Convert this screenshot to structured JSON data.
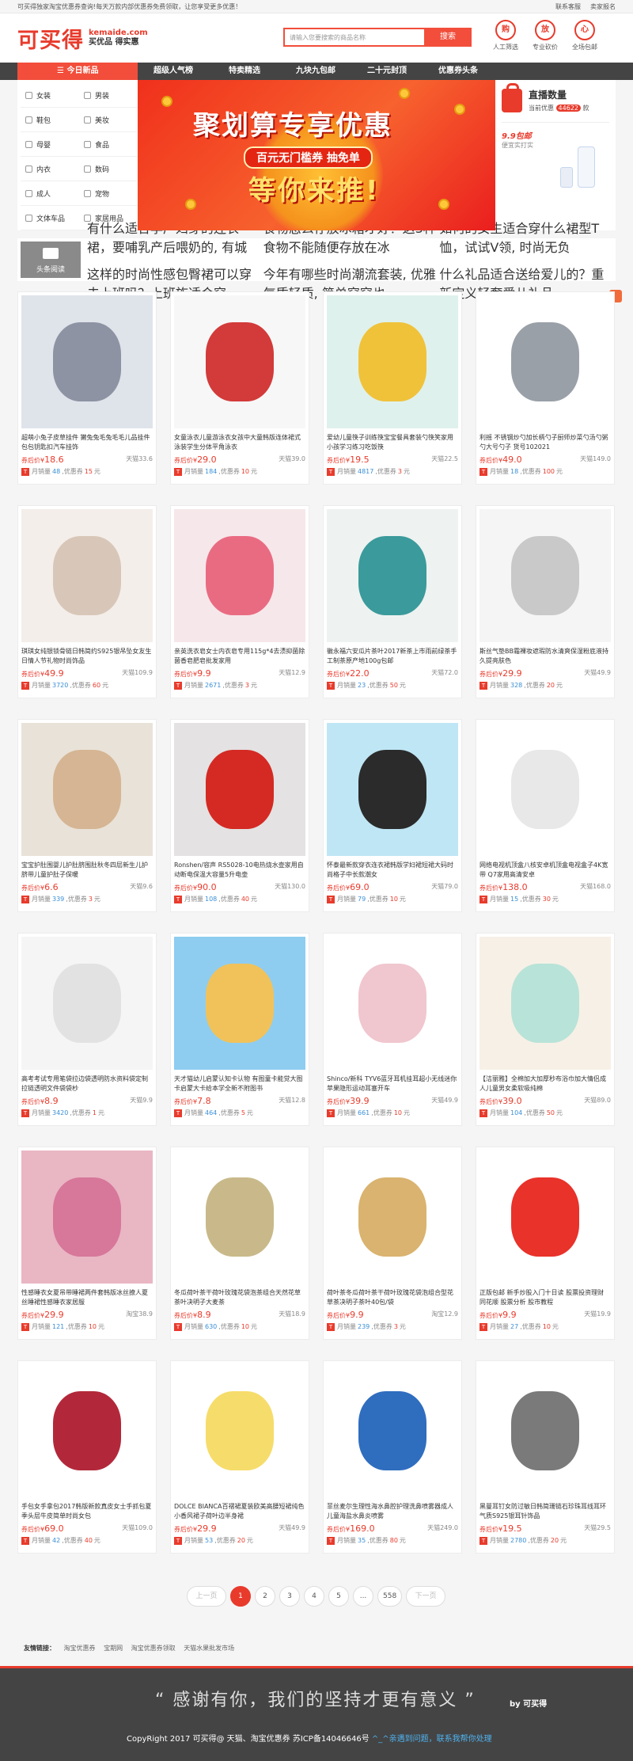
{
  "topbar": {
    "left": "可买得独家淘宝优惠券查询!每天万款内部优惠券免费领取，让您享受更多优惠！",
    "help": "联系客服",
    "join": "卖家报名"
  },
  "header": {
    "logo": "可买得",
    "domain": "kemaide.com",
    "slogan": "买优品 得实惠",
    "search_placeholder": "请输入您要搜索的商品名称",
    "search_button": "搜索",
    "icons": [
      {
        "glyph": "购",
        "label": "人工筛选"
      },
      {
        "glyph": "放",
        "label": "专业砍价"
      },
      {
        "glyph": "心",
        "label": "全场包邮"
      }
    ]
  },
  "nav": {
    "category": "☰ 今日新品",
    "items": [
      "超级人气榜",
      "特卖精选",
      "九块九包邮",
      "二十元封顶",
      "优惠券头条"
    ]
  },
  "categories": [
    [
      "女装",
      "男装"
    ],
    [
      "鞋包",
      "美妆"
    ],
    [
      "母婴",
      "食品"
    ],
    [
      "内衣",
      "数码"
    ],
    [
      "成人",
      "宠物"
    ],
    [
      "文体车品",
      "家居用品"
    ]
  ],
  "banner": {
    "line1": "聚划算专享优惠",
    "line2": "百元无门槛券 抽免单",
    "line3": "等你来推!"
  },
  "side": {
    "live_title": "直播数量",
    "live_prefix": "当前优惠",
    "live_count": "44622",
    "live_suffix": "款",
    "ninep_title": "9.9包邮",
    "ninep_sub": "便宜实打实"
  },
  "headline": {
    "label": "头条阅读",
    "items": [
      "有什么适合孕产妇穿的连衣裙，要哺乳产后喂奶的, 有城",
      "食物怎么存放冰箱才好？这3种食物不能随便存放在冰",
      "如何的女生适合穿什么裙型T恤，试试V领, 时尚无负",
      "这样的时尚性感包臀裙可以穿去上班吗？上班族适合穿",
      "今年有哪些时尚潮流套装, 优雅气质轻质, 简单穿穿也",
      "什么礼品适合送给爱儿的？重新定义轻奢爱儿礼品"
    ]
  },
  "products": [
    {
      "title": "超萌小兔子皮草挂件 獭兔兔毛兔毛毛儿品挂件包包钥匙扣汽车挂饰",
      "coupon_price": "18.6",
      "platform": "天猫",
      "orig": "33.6",
      "sales": "48",
      "coupon": "15"
    },
    {
      "title": "女童泳衣儿童游泳衣女孩中大童韩版连体裙式泳装学生分体平角泳衣",
      "coupon_price": "29.0",
      "platform": "天猫",
      "orig": "39.0",
      "sales": "184",
      "coupon": "10"
    },
    {
      "title": "爱幼儿童筷子训练筷宝宝餐具套装勺筷笑家用小孩学习练习吃饭筷",
      "coupon_price": "19.5",
      "platform": "天猫",
      "orig": "22.5",
      "sales": "4817",
      "coupon": "3"
    },
    {
      "title": "利摇 不锈钢炒勺加长柄勺子厨师炒菜勺汤勺粥勺大号勺子 货号102021",
      "coupon_price": "49.0",
      "platform": "天猫",
      "orig": "149.0",
      "sales": "18",
      "coupon": "100"
    },
    {
      "title": "琪琪女纯银锁骨链日韩简约S925银吊坠女友生日情人节礼物时尚饰品",
      "coupon_price": "49.9",
      "platform": "天猫",
      "orig": "109.9",
      "sales": "3720",
      "coupon": "60"
    },
    {
      "title": "亲英洗衣皂女士内衣皂专用115g*4去渍抑菌除菌香皂肥皂批发家用",
      "coupon_price": "9.9",
      "platform": "天猫",
      "orig": "12.9",
      "sales": "2671",
      "coupon": "3"
    },
    {
      "title": "徽永福六安瓜片茶叶2017新茶上市雨前绿茶手工制茶原产地100g包邮",
      "coupon_price": "22.0",
      "platform": "天猫",
      "orig": "72.0",
      "sales": "23",
      "coupon": "50"
    },
    {
      "title": "斯丝气垫BB霜裸妆遮瑕防水清爽保湿粉底液持久提亮肤色",
      "coupon_price": "29.9",
      "platform": "天猫",
      "orig": "49.9",
      "sales": "328",
      "coupon": "20"
    },
    {
      "title": "宝宝护肚围婴儿护肚脐围肚秋冬四层新生儿护脐带儿童护肚子保暖",
      "coupon_price": "6.6",
      "platform": "天猫",
      "orig": "9.6",
      "sales": "339",
      "coupon": "3"
    },
    {
      "title": "Ronshen/容声 RS5028-10电热烧水壶家用自动断电保温大容量5升电壶",
      "coupon_price": "90.0",
      "platform": "天猫",
      "orig": "130.0",
      "sales": "108",
      "coupon": "40"
    },
    {
      "title": "怀泰最新款穿衣连衣裙韩版学妇裙短裙大码时尚格子中长款潮女",
      "coupon_price": "69.0",
      "platform": "天猫",
      "orig": "79.0",
      "sales": "79",
      "coupon": "10"
    },
    {
      "title": "网络电视机顶盒八核安卓机顶盒电视盒子4K宽带 Q7家用高清安卓",
      "coupon_price": "138.0",
      "platform": "天猫",
      "orig": "168.0",
      "sales": "15",
      "coupon": "30"
    },
    {
      "title": "高考考试专用笔袋拉边袋透明防水资料袋定制拉链透明文件袋袋杪",
      "coupon_price": "8.9",
      "platform": "天猫",
      "orig": "9.9",
      "sales": "3420",
      "coupon": "1"
    },
    {
      "title": "天才猫幼儿启蒙认知卡认物 有图童卡能觉大图卡启蒙大卡给本学全新不附图书",
      "coupon_price": "7.8",
      "platform": "天猫",
      "orig": "12.8",
      "sales": "464",
      "coupon": "5"
    },
    {
      "title": "Shinco/新科 TYV6蓝牙耳机挂耳超小无线迷你苹果隐形运动耳塞开车",
      "coupon_price": "39.9",
      "platform": "天猫",
      "orig": "49.9",
      "sales": "661",
      "coupon": "10"
    },
    {
      "title": "【洁丽雅】全棉加大加厚秒布浴巾加大情侣成人儿童男女柔软吸纯棉",
      "coupon_price": "39.0",
      "platform": "天猫",
      "orig": "89.0",
      "sales": "104",
      "coupon": "50"
    },
    {
      "title": "性感睡衣女夏吊带睡裙两件套韩版冰丝撩人夏丝睡裙性感睡衣家居服",
      "coupon_price": "29.9",
      "platform": "淘宝",
      "orig": "38.9",
      "sales": "121",
      "coupon": "10"
    },
    {
      "title": "冬瓜荷叶茶干荷叶玫瑰花袋泡茶组合天然花草茶叶决明子大麦茶",
      "coupon_price": "8.9",
      "platform": "天猫",
      "orig": "18.9",
      "sales": "630",
      "coupon": "10"
    },
    {
      "title": "荷叶茶冬瓜荷叶茶干荷叶玫瑰花袋泡组合型花草茶决明子茶叶40包/袋",
      "coupon_price": "9.9",
      "platform": "淘宝",
      "orig": "12.9",
      "sales": "239",
      "coupon": "3"
    },
    {
      "title": "正版包邮 新手炒股入门十日读 股票投资理财 同花顺 股票分析 股市教程",
      "coupon_price": "9.9",
      "platform": "天猫",
      "orig": "19.9",
      "sales": "27",
      "coupon": "10"
    },
    {
      "title": "手包女手拿包2017韩版新款真皮女士手抓包夏季头层牛皮简单时尚女包",
      "coupon_price": "69.0",
      "platform": "天猫",
      "orig": "109.0",
      "sales": "42",
      "coupon": "40"
    },
    {
      "title": "DOLCE BIANCA百褶裙夏装欧美高腰短裙纯色小香风裙子荷叶边半身裙",
      "coupon_price": "29.9",
      "platform": "天猫",
      "orig": "49.9",
      "sales": "53",
      "coupon": "20"
    },
    {
      "title": "菲丝麦尔生理性海水鼻腔护理洗鼻喷雾器成人儿童海盐水鼻炎喷雾",
      "coupon_price": "169.0",
      "platform": "天猫",
      "orig": "249.0",
      "sales": "35",
      "coupon": "80"
    },
    {
      "title": "黑曼耳钉女防过敏日韩简珊链石珍珠耳线耳环气质S925银耳针饰品",
      "coupon_price": "19.5",
      "platform": "天猫",
      "orig": "29.5",
      "sales": "2780",
      "coupon": "20"
    }
  ],
  "labels": {
    "coupon_after": "券后价",
    "sales": "月销量",
    "coupon": "优惠券",
    "yuan": "元",
    "currency": "¥"
  },
  "pager": {
    "prev": "上一页",
    "pages": [
      "1",
      "2",
      "3",
      "4",
      "5",
      "...",
      "558"
    ],
    "next": "下一页"
  },
  "links": {
    "label": "友情链接：",
    "items": [
      "淘宝优惠券",
      "宝期网",
      "淘宝优惠券领取",
      "天猫水果批发市场"
    ]
  },
  "footer": {
    "quote": "“ 感谢有你，我们的坚持才更有意义 ”",
    "by": "by  可买得",
    "copy": "CopyRight 2017  可买得@ 天猫、淘宝优惠券    苏ICP备14046646号",
    "contact": "^_^亲遇到问题，联系我帮你处理"
  },
  "colors": {
    "accent": "#e83b2c",
    "nav_bg": "#444444",
    "link_blue": "#3a8fd6"
  }
}
